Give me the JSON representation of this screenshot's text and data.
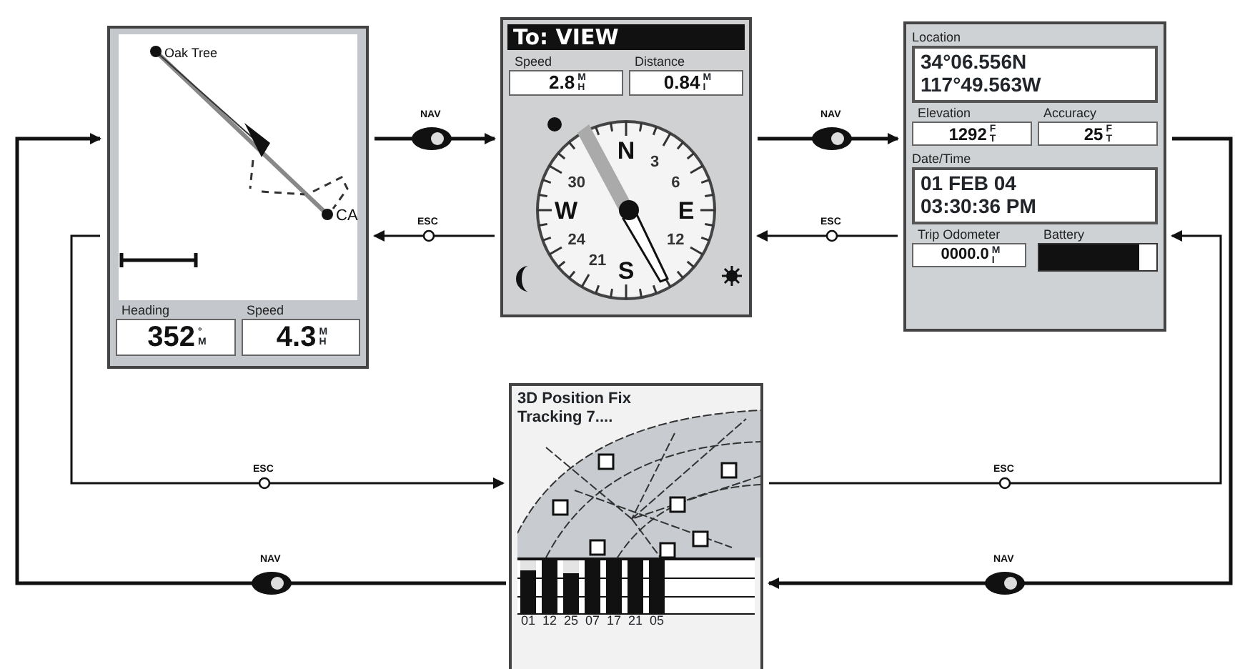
{
  "map_screen": {
    "waypoints": [
      "Oak Tree",
      "CA"
    ],
    "fields": [
      {
        "label": "Heading",
        "value": "352",
        "unit": "°M"
      },
      {
        "label": "Speed",
        "value": "4.3",
        "unit": "MH"
      }
    ]
  },
  "compass_screen": {
    "title": "To: VIEW",
    "fields": [
      {
        "label": "Speed",
        "value": "2.8",
        "unit": "MH"
      },
      {
        "label": "Distance",
        "value": "0.84",
        "unit": "MI"
      }
    ],
    "dial_labels": [
      {
        "text": "N",
        "kind": "cardinal"
      },
      {
        "text": "3",
        "kind": "number"
      },
      {
        "text": "30",
        "kind": "number"
      },
      {
        "text": "6",
        "kind": "number"
      },
      {
        "text": "W",
        "kind": "cardinal"
      },
      {
        "text": "E",
        "kind": "cardinal"
      },
      {
        "text": "24",
        "kind": "number"
      },
      {
        "text": "12",
        "kind": "number"
      },
      {
        "text": "21",
        "kind": "number"
      },
      {
        "text": "S",
        "kind": "cardinal"
      }
    ]
  },
  "status_screen": {
    "location_label": "Location",
    "location": [
      "34°06.556N",
      "117°49.563W"
    ],
    "fields": [
      {
        "label": "Elevation",
        "value": "1292",
        "unit": "FT"
      },
      {
        "label": "Accuracy",
        "value": "25",
        "unit": "FT"
      }
    ],
    "datetime_label": "Date/Time",
    "datetime": [
      "01 FEB 04",
      "03:30:36 PM"
    ],
    "odometer": {
      "label": "Trip Odometer",
      "value": "0000.0",
      "unit": "MI"
    },
    "battery": {
      "label": "Battery",
      "level": 0.85
    }
  },
  "satellite_screen": {
    "status": "3D Position Fix",
    "tracking": "Tracking 7....",
    "satellites": [
      {
        "id": "01",
        "level": 0.8
      },
      {
        "id": "12",
        "level": 1
      },
      {
        "id": "25",
        "level": 0.75
      },
      {
        "id": "07",
        "level": 1
      },
      {
        "id": "17",
        "level": 1
      },
      {
        "id": "21",
        "level": 1
      },
      {
        "id": "05",
        "level": 1
      }
    ]
  },
  "transitions": [
    {
      "label": "NAV",
      "kind": "nav"
    },
    {
      "label": "ESC",
      "kind": "esc"
    },
    {
      "label": "NAV",
      "kind": "nav"
    },
    {
      "label": "ESC",
      "kind": "esc"
    },
    {
      "label": "NAV",
      "kind": "nav"
    },
    {
      "label": "ESC",
      "kind": "esc"
    },
    {
      "label": "NAV",
      "kind": "nav"
    },
    {
      "label": "ESC",
      "kind": "esc"
    }
  ]
}
